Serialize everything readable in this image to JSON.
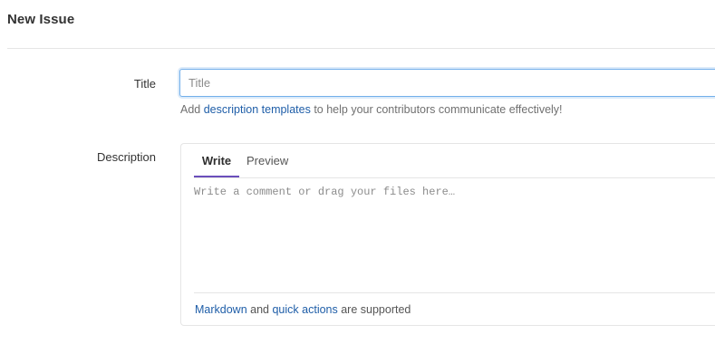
{
  "page": {
    "title": "New Issue"
  },
  "form": {
    "title_label": "Title",
    "title_placeholder": "Title",
    "title_value": "",
    "help_prefix": "Add ",
    "help_link": "description templates",
    "help_suffix": " to help your contributors communicate effectively!",
    "description_label": "Description"
  },
  "editor": {
    "tabs": [
      {
        "label": "Write",
        "active": true
      },
      {
        "label": "Preview",
        "active": false
      }
    ],
    "placeholder": "Write a comment or drag your files here…",
    "footer_link_markdown": "Markdown",
    "footer_and": " and ",
    "footer_link_quick_actions": "quick actions",
    "footer_suffix": " are supported"
  },
  "colors": {
    "accent_tab": "#6b4fbb",
    "link": "#1f5ea8",
    "focus_border": "#73afea"
  }
}
